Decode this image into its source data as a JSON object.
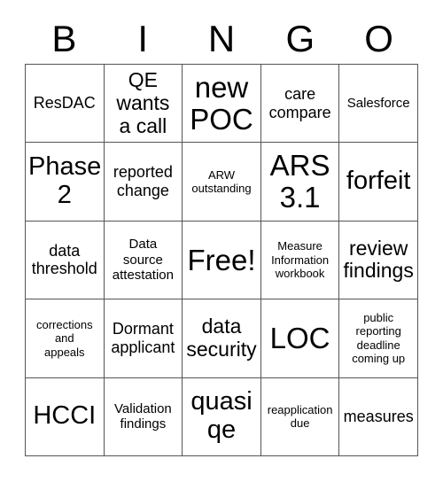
{
  "card": {
    "header_letters": [
      "B",
      "I",
      "N",
      "G",
      "O"
    ],
    "grid_size": 5,
    "free_space_label": "Free!",
    "colors": {
      "background": "#ffffff",
      "text": "#000000",
      "border": "#555555"
    },
    "rows": [
      [
        {
          "text": "ResDAC",
          "size": "m"
        },
        {
          "text": "QE\nwants\na call",
          "size": "l"
        },
        {
          "text": "new\nPOC",
          "size": "xxl"
        },
        {
          "text": "care\ncompare",
          "size": "m"
        },
        {
          "text": "Salesforce",
          "size": "s"
        }
      ],
      [
        {
          "text": "Phase\n2",
          "size": "xl"
        },
        {
          "text": "reported\nchange",
          "size": "m"
        },
        {
          "text": "ARW\noutstanding",
          "size": "xs"
        },
        {
          "text": "ARS\n3.1",
          "size": "xxl"
        },
        {
          "text": "forfeit",
          "size": "xl"
        }
      ],
      [
        {
          "text": "data\nthreshold",
          "size": "m"
        },
        {
          "text": "Data\nsource\nattestation",
          "size": "s"
        },
        {
          "text": "Free!",
          "size": "xxl"
        },
        {
          "text": "Measure\nInformation\nworkbook",
          "size": "xs"
        },
        {
          "text": "review\nfindings",
          "size": "l"
        }
      ],
      [
        {
          "text": "corrections\nand\nappeals",
          "size": "xs"
        },
        {
          "text": "Dormant\napplicant",
          "size": "m"
        },
        {
          "text": "data\nsecurity",
          "size": "l"
        },
        {
          "text": "LOC",
          "size": "xxl"
        },
        {
          "text": "public\nreporting\ndeadline\ncoming up",
          "size": "xs"
        }
      ],
      [
        {
          "text": "HCCI",
          "size": "xl"
        },
        {
          "text": "Validation\nfindings",
          "size": "s"
        },
        {
          "text": "quasi\nqe",
          "size": "xl"
        },
        {
          "text": "reapplication\ndue",
          "size": "xs"
        },
        {
          "text": "measures",
          "size": "m"
        }
      ]
    ]
  }
}
